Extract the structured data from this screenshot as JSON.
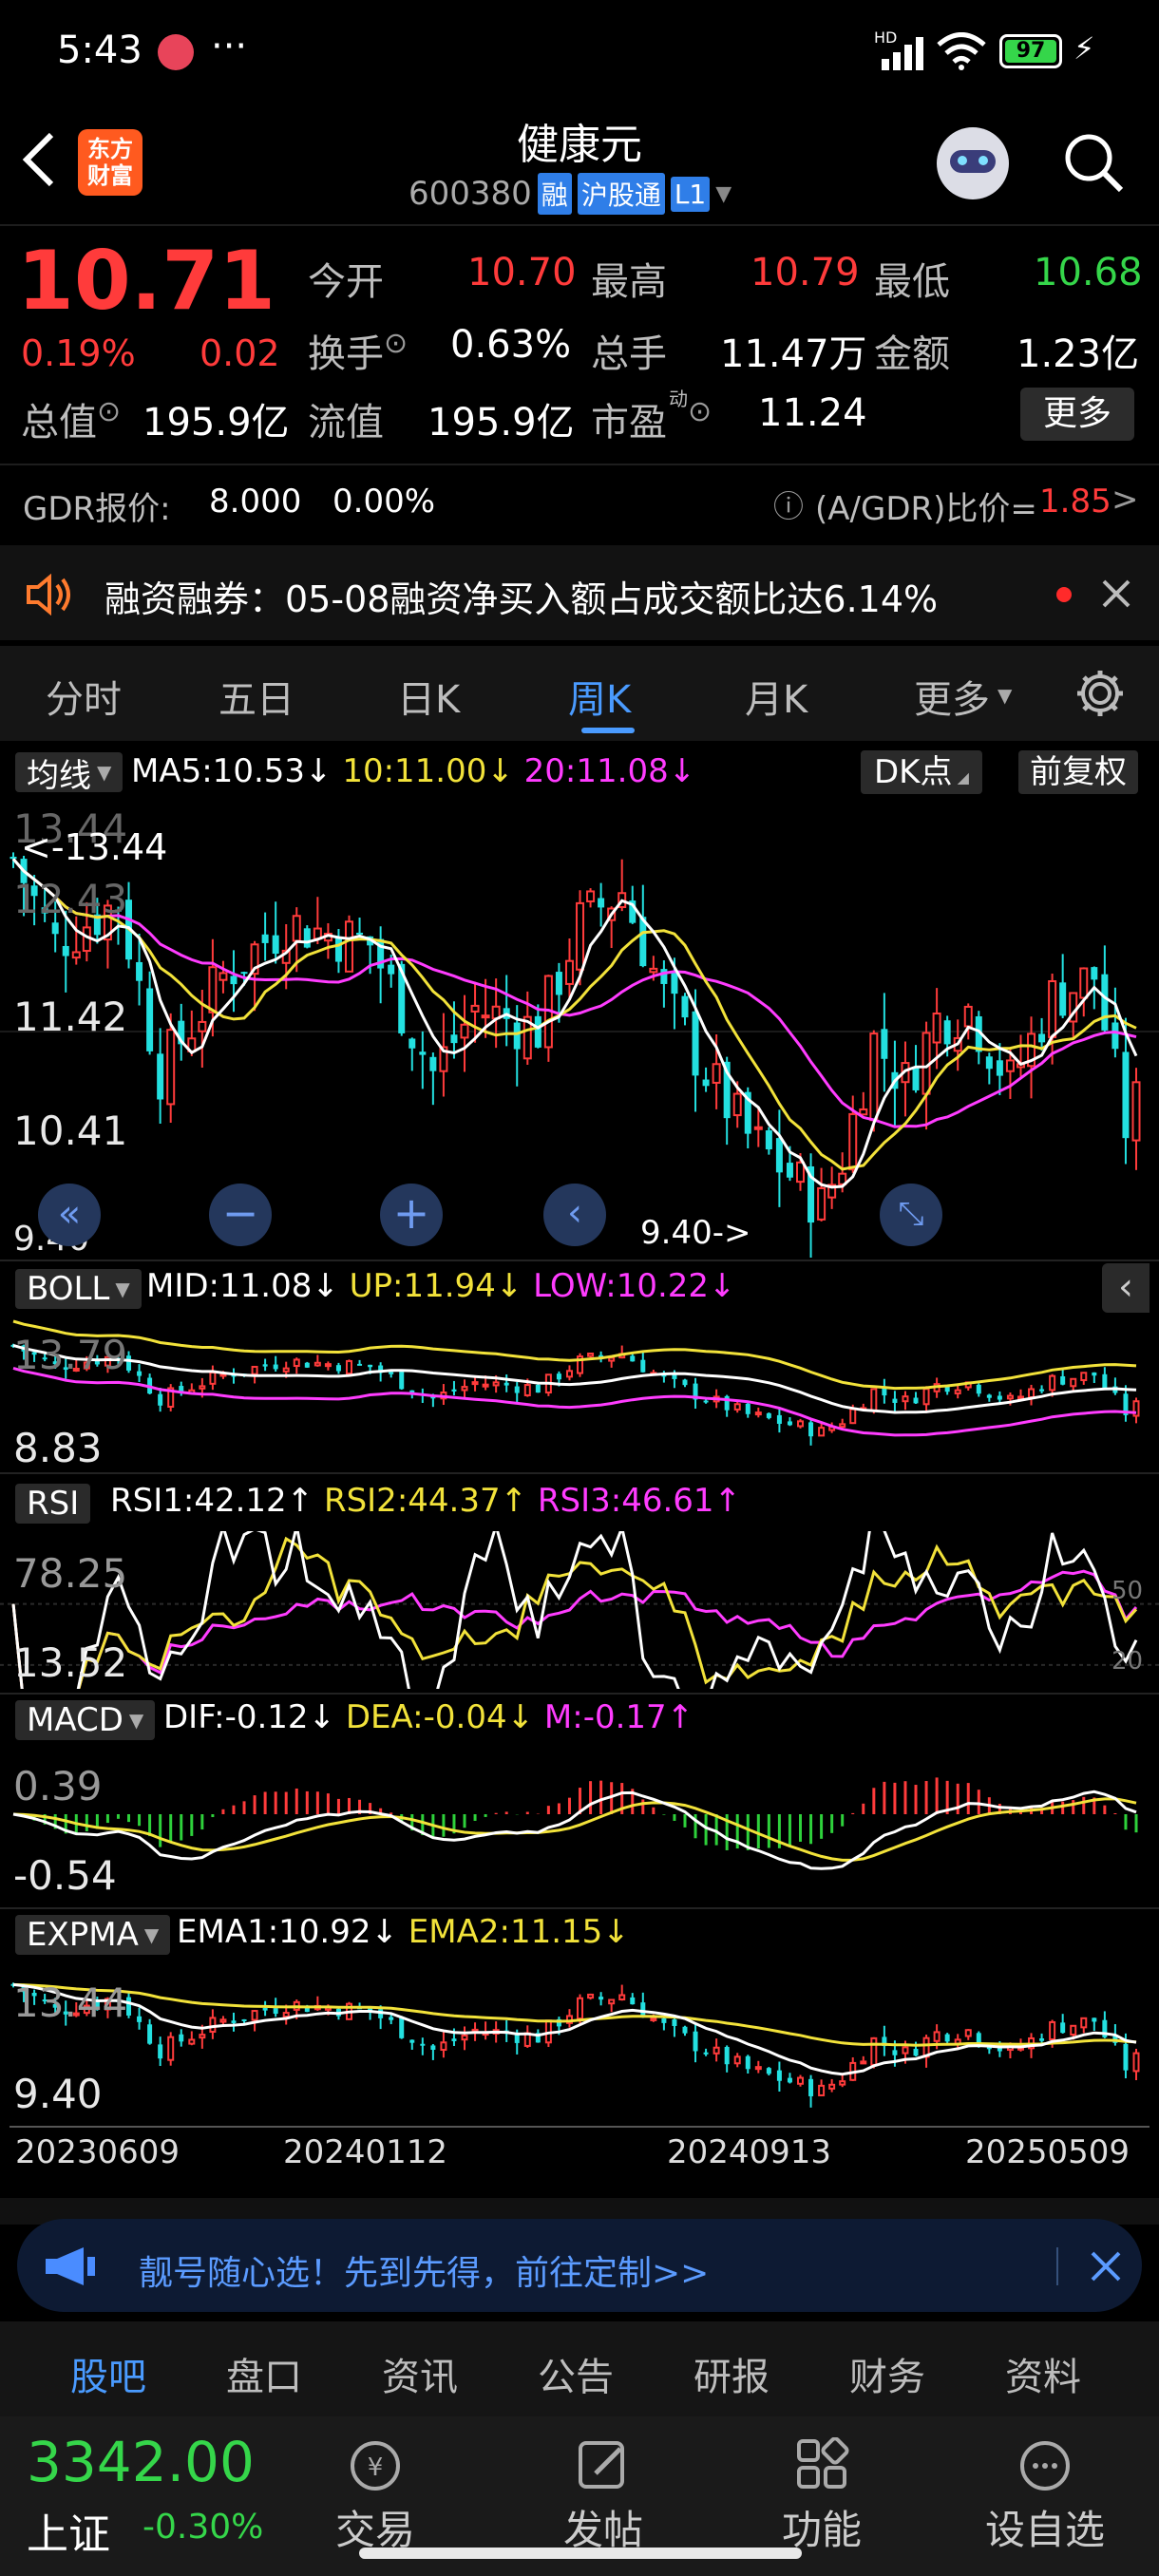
{
  "status_bar": {
    "time": "5:43",
    "dots": "···",
    "battery": "97",
    "hd": "HD"
  },
  "header": {
    "title": "健康元",
    "code": "600380",
    "badges": [
      "融",
      "沪股通",
      "L1"
    ],
    "logo_line1": "东方",
    "logo_line2": "财富"
  },
  "quote": {
    "price": "10.71",
    "change_pct": "0.19%",
    "change": "0.02",
    "fields": [
      {
        "label": "今开",
        "value": "10.70",
        "color": "#ff3b3b"
      },
      {
        "label": "最高",
        "value": "10.79",
        "color": "#ff3b3b"
      },
      {
        "label": "最低",
        "value": "10.68",
        "color": "#35d64a"
      },
      {
        "label": "换手",
        "value": "0.63%",
        "color": "#ffffff"
      },
      {
        "label": "总手",
        "value": "11.47万",
        "color": "#ffffff"
      },
      {
        "label": "金额",
        "value": "1.23亿",
        "color": "#ffffff"
      },
      {
        "label": "总值",
        "value": "195.9亿",
        "color": "#ffffff"
      },
      {
        "label": "流值",
        "value": "195.9亿",
        "color": "#ffffff"
      },
      {
        "label": "市盈",
        "value": "11.24",
        "color": "#ffffff"
      }
    ],
    "more_button": "更多",
    "pe_superscript": "动"
  },
  "gdr": {
    "label": "GDR报价:",
    "price": "8.000",
    "pct": "0.00%",
    "ratio_label": "(A/GDR)比价=",
    "ratio": "1.85",
    "arrow": ">"
  },
  "notice": {
    "text": "融资融券：05-08融资净买入额占成交额比达6.14%"
  },
  "tabs": {
    "items": [
      "分时",
      "五日",
      "日K",
      "周K",
      "月K",
      "更多"
    ],
    "active": "周K"
  },
  "main_chart": {
    "tag": "均线",
    "ma5": "MA5:10.53",
    "ma10": "10:11.00",
    "ma20": "20:11.08",
    "dk": "DK点",
    "fq": "前复权",
    "y_top": "13.44",
    "y_mid1": "12.43",
    "y_mid2": "11.42",
    "y_mid3": "10.41",
    "y_bottom": "9.40",
    "max_mark": "<-13.44",
    "min_mark": "9.40->"
  },
  "boll": {
    "tag": "BOLL",
    "mid": "MID:11.08",
    "up": "UP:11.94",
    "low": "LOW:10.22",
    "y_top": "13.79",
    "y_bottom": "8.83"
  },
  "rsi": {
    "tag": "RSI",
    "rsi1": "RSI1:42.12",
    "rsi2": "RSI2:44.37",
    "rsi3": "RSI3:46.61",
    "y_top": "78.25",
    "y_bottom": "13.52",
    "ref50": "50",
    "ref20": "20"
  },
  "macd": {
    "tag": "MACD",
    "dif": "DIF:-0.12",
    "dea": "DEA:-0.04",
    "m": "M:-0.17",
    "y_top": "0.39",
    "y_bottom": "-0.54"
  },
  "expma": {
    "tag": "EXPMA",
    "ema1": "EMA1:10.92",
    "ema2": "EMA2:11.15",
    "y_top": "13.44",
    "y_bottom": "9.40"
  },
  "dates": [
    "20230609",
    "20240112",
    "20240913",
    "20250509"
  ],
  "banner": {
    "text": "靓号随心选！先到先得，前往定制>>"
  },
  "section_tabs": [
    "股吧",
    "盘口",
    "资讯",
    "公告",
    "研报",
    "财务",
    "资料"
  ],
  "bottom_nav": {
    "index_value": "3342.00",
    "index_name": "上证",
    "index_pct": "-0.30%",
    "items": [
      "交易",
      "发帖",
      "功能",
      "设自选"
    ]
  }
}
